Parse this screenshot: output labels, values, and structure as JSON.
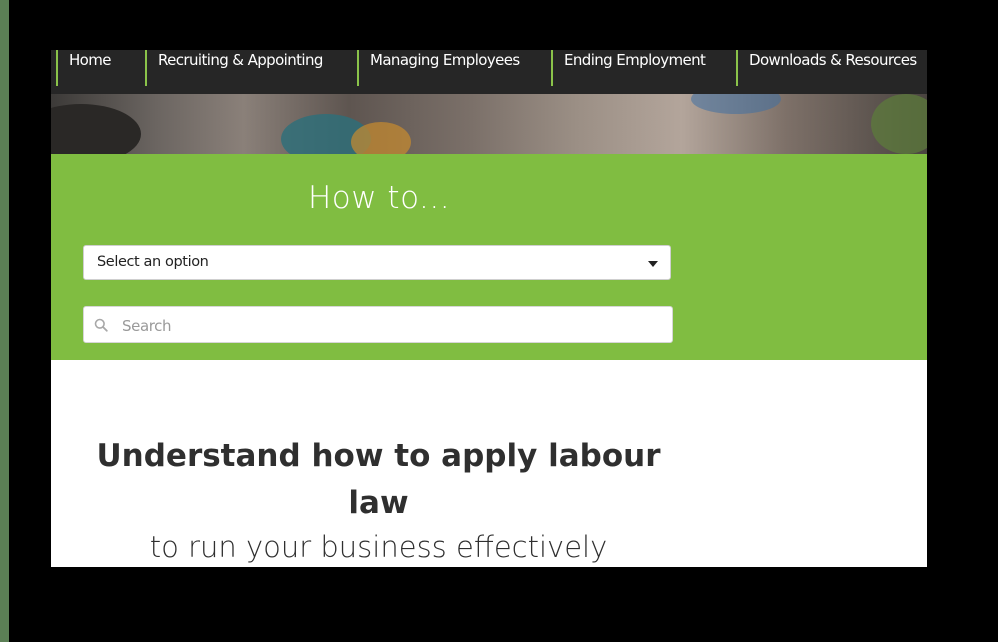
{
  "nav": {
    "items": [
      {
        "label": "Home"
      },
      {
        "label": "Recruiting & Appointing"
      },
      {
        "label": "Managing Employees"
      },
      {
        "label": "Ending Employment"
      },
      {
        "label": "Downloads & Resources"
      }
    ]
  },
  "finder": {
    "heading": "How to...",
    "select_value": "Select an option",
    "search_placeholder": "Search"
  },
  "content": {
    "headline": "Understand how to apply labour law",
    "subheadline": "to run your business effectively"
  },
  "colors": {
    "accent_green": "#80bd41",
    "nav_background": "#262626",
    "page_background": "#000000"
  }
}
